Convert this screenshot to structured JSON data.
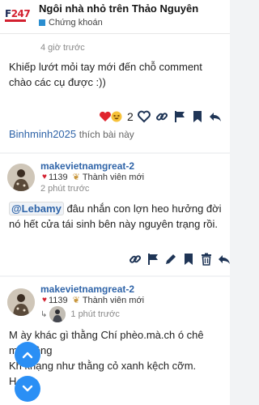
{
  "header": {
    "logo_main": "F",
    "logo_accent": "247",
    "title": "Ngôi nhà nhỏ trên Thảo Nguyên",
    "category": "Chứng khoán"
  },
  "post1": {
    "time": "4 giờ trước",
    "text": "Khiếp lướt mỏi tay mới đến chỗ comment chào các cụ được :))",
    "reaction_count": "2",
    "liked_user": "Binhminh2025",
    "liked_text": "thích bài này"
  },
  "post2": {
    "author": "makevietnamgreat-2",
    "hearts": "1139",
    "rank": "Thành viên mới",
    "time": "2 phút trước",
    "mention": "@Lebamy",
    "text": "đâu nhắn con lợn heo hưởng đời nó hết cửa tái sinh bên này nguyên trạng rồi."
  },
  "post3": {
    "author": "makevietnamgreat-2",
    "hearts": "1139",
    "rank": "Thành viên mới",
    "time": "1 phút trước",
    "line1": "M ày khác gì thằng Chí phèo.mà.ch ó chê",
    "line2": "m  m.lông",
    "line3": "Kh  khạng như thằng cỏ xanh kệch cỡm.",
    "line4": "H"
  },
  "colors": {
    "accent": "#2a8ff5",
    "brand_red": "#d3202f",
    "link": "#2f64a8"
  }
}
